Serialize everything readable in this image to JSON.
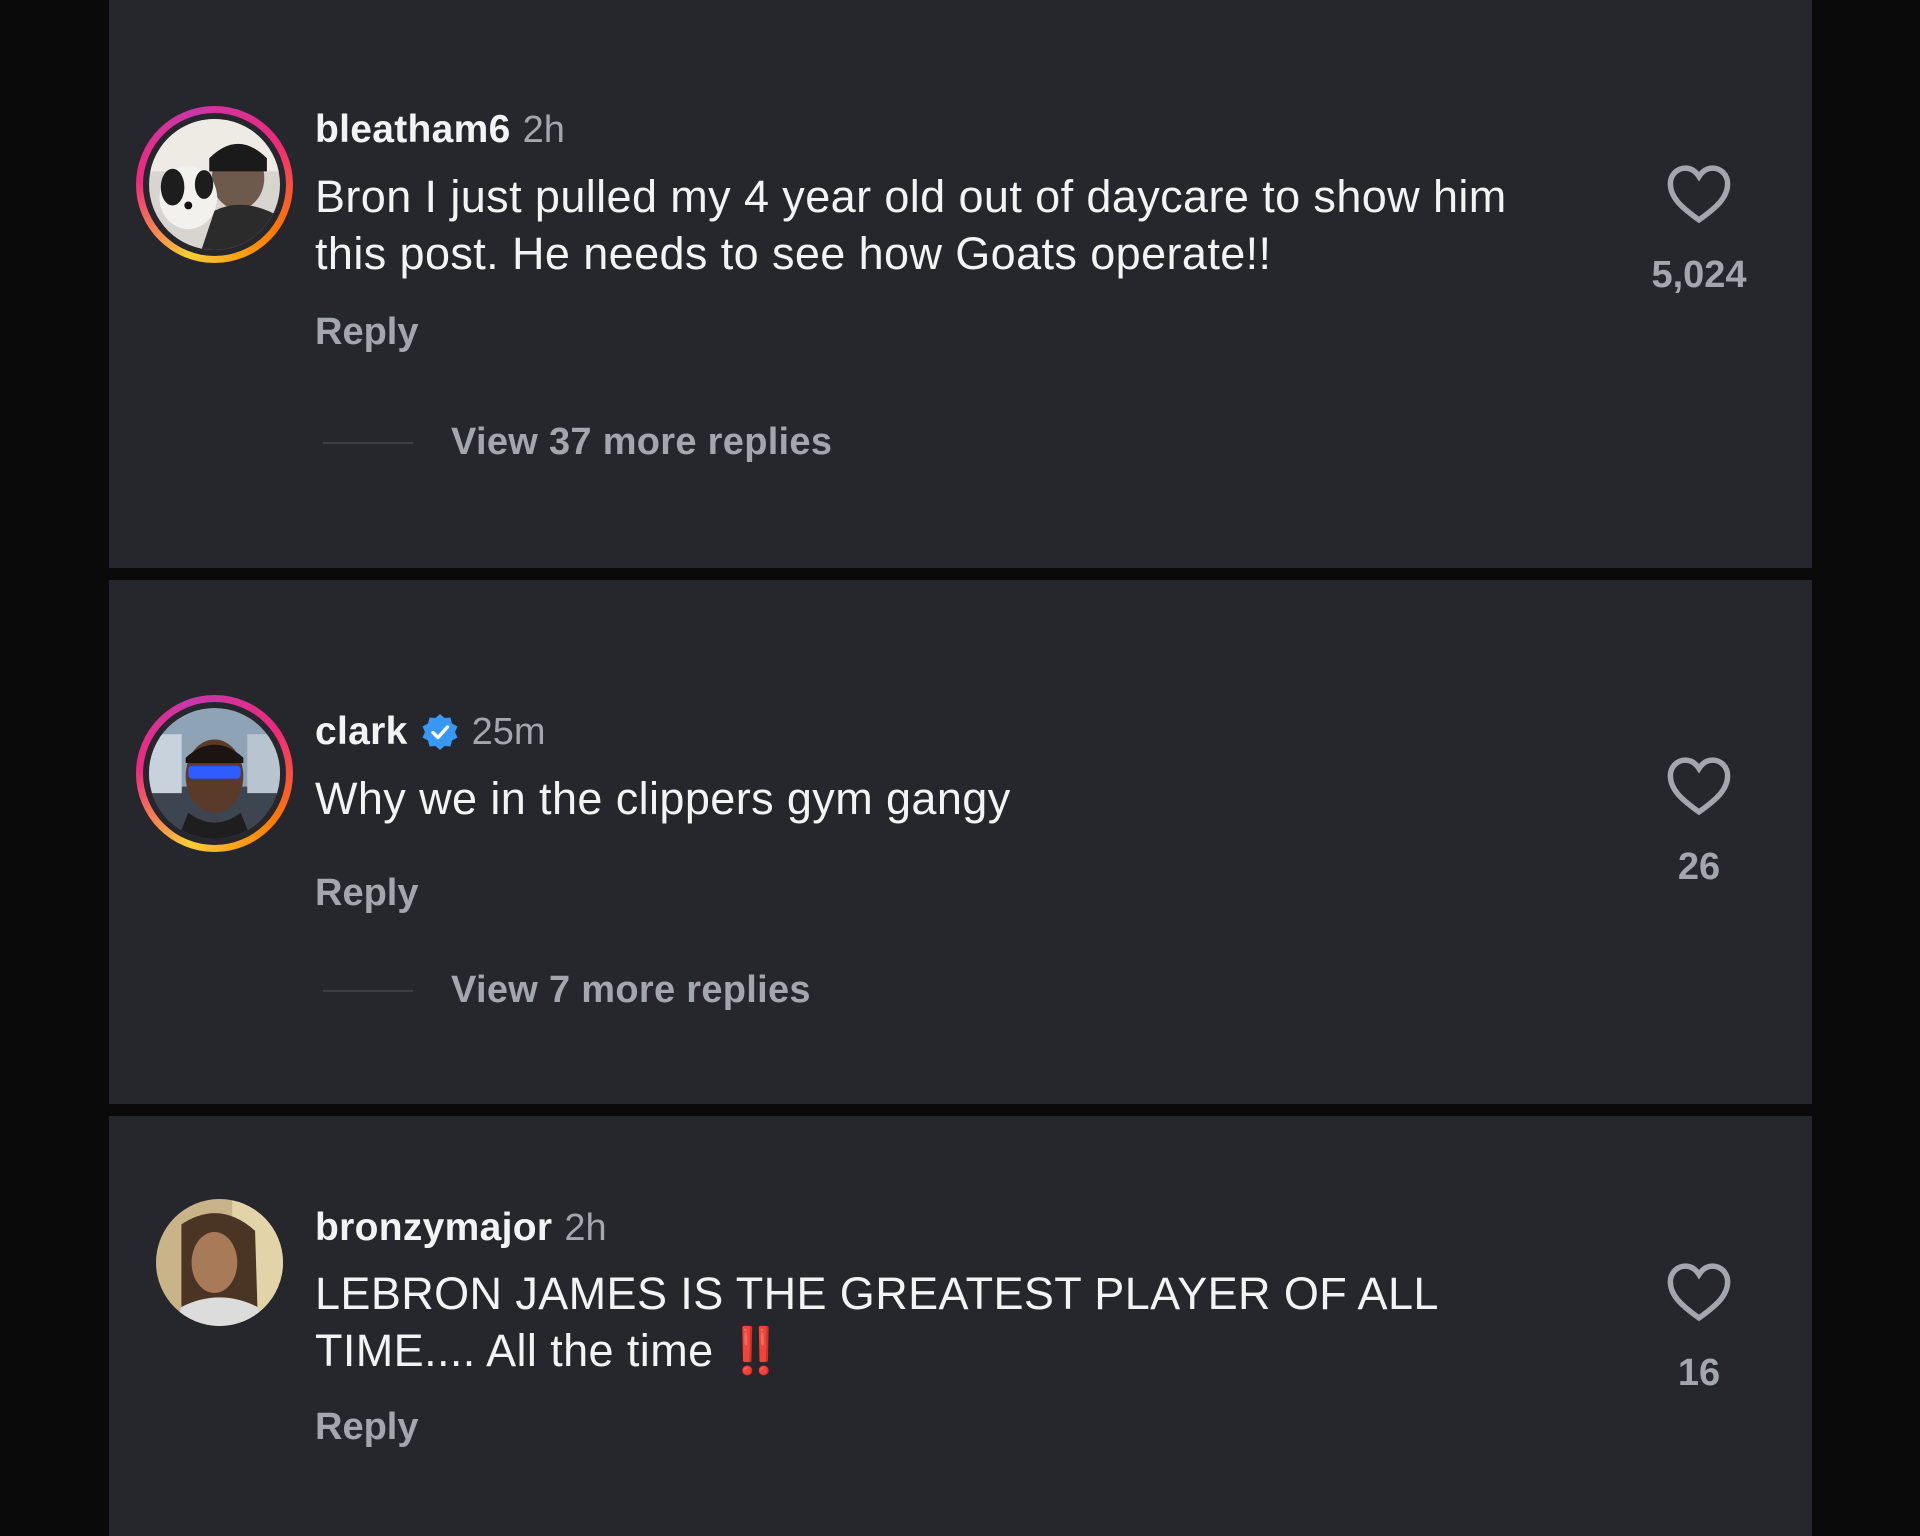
{
  "comments": [
    {
      "username": "bleatham6",
      "time": "2h",
      "verified": false,
      "text": "Bron I just pulled my 4 year old out of daycare to show him this post. He needs to see how Goats operate!!",
      "reply_label": "Reply",
      "like_count": "5,024",
      "view_more": "View 37 more replies",
      "avatar_ring": true
    },
    {
      "username": "clark",
      "time": "25m",
      "verified": true,
      "text": "Why we in the clippers gym gangy",
      "reply_label": "Reply",
      "like_count": "26",
      "view_more": "View 7 more replies",
      "avatar_ring": true
    },
    {
      "username": "bronzymajor",
      "time": "2h",
      "verified": false,
      "text": "LEBRON JAMES IS THE GREATEST PLAYER OF ALL TIME.... All the time",
      "emoji": "‼️",
      "reply_label": "Reply",
      "like_count": "16",
      "avatar_ring": false
    }
  ],
  "icons": {
    "like": "heart-outline-icon",
    "verified": "verified-badge-icon"
  },
  "colors": {
    "card": "#25272d",
    "background": "#0a0a0b",
    "text": "#f2f3f5",
    "muted": "#a3a6ad",
    "verified": "#3897f0",
    "emoji": "#e32222"
  }
}
